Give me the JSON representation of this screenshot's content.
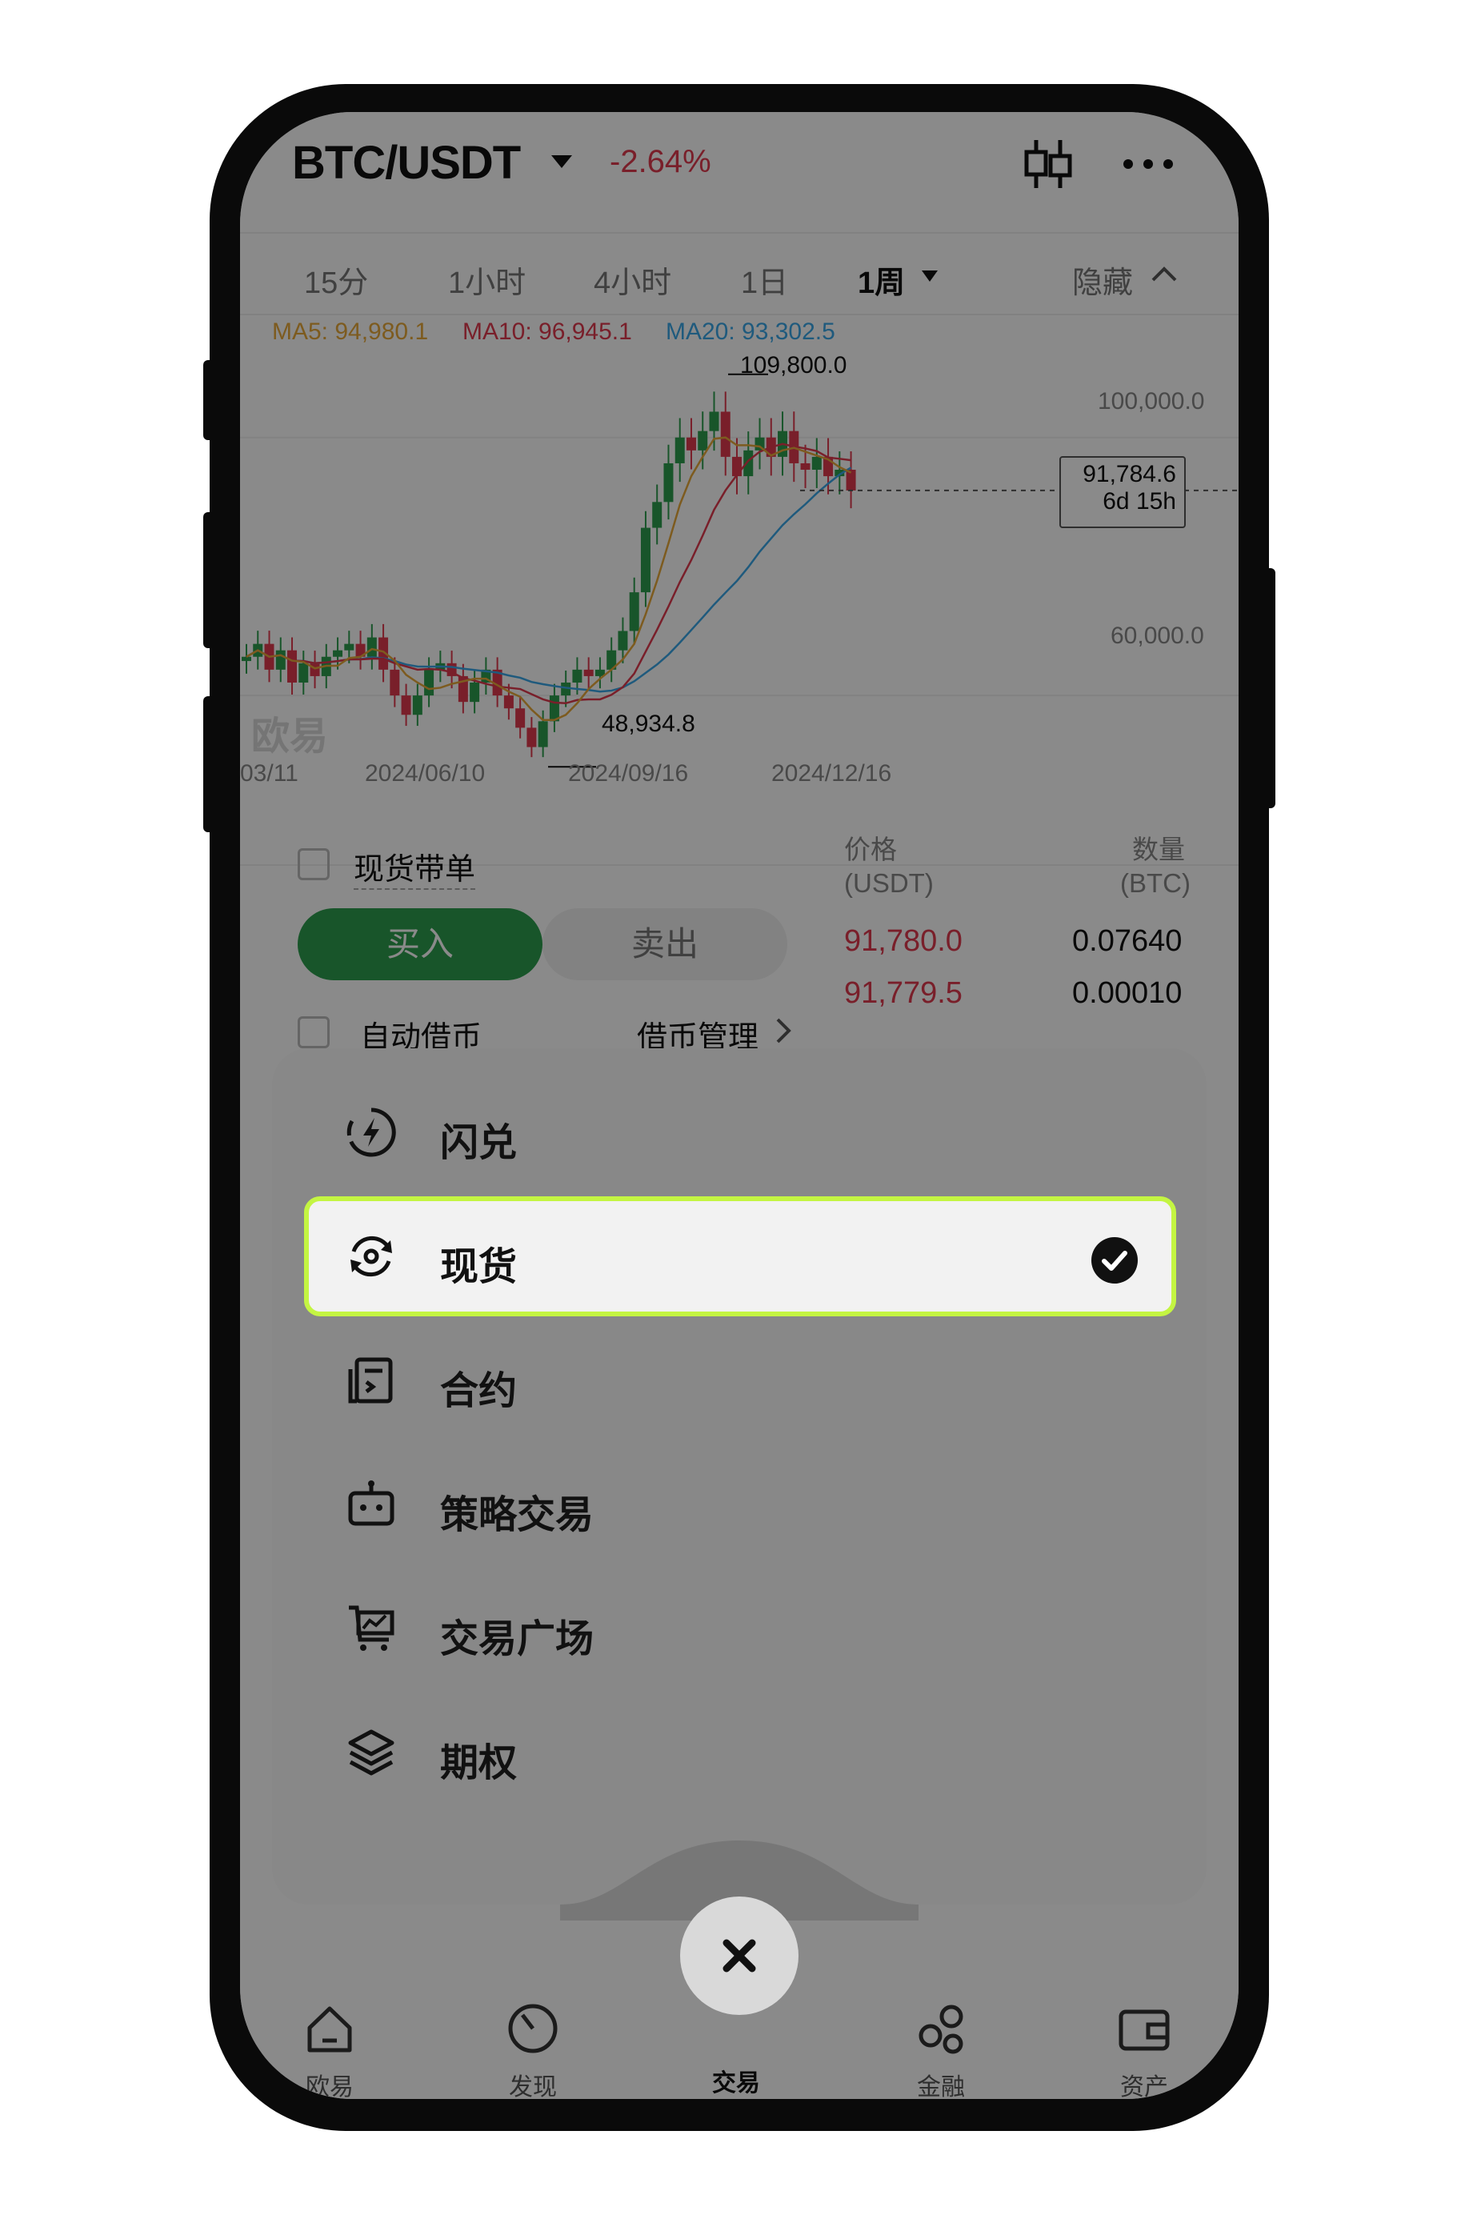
{
  "header": {
    "pair": "BTC/USDT",
    "change": "-2.64%"
  },
  "timeframes": [
    {
      "label": "15分"
    },
    {
      "label": "1小时"
    },
    {
      "label": "4小时"
    },
    {
      "label": "1日"
    },
    {
      "label": "1周"
    }
  ],
  "hide_label": "隐藏",
  "ma": {
    "ma5": "MA5: 94,980.1",
    "ma10": "MA10: 96,945.1",
    "ma20": "MA20: 93,302.5"
  },
  "chart": {
    "high_label": "109,800.0",
    "low_label": "48,934.8",
    "y_ticks": [
      "100,000.0",
      "60,000.0"
    ],
    "x_ticks": [
      "03/11",
      "2024/06/10",
      "2024/09/16",
      "2024/12/16"
    ],
    "current_price": "91,784.6",
    "countdown": "6d 15h",
    "watermark": "欧易",
    "colors": {
      "up": "#2e9e4e",
      "down": "#e03a4e",
      "ma5": "#e7a93a",
      "ma10": "#e03a4e",
      "ma20": "#3aa7e7"
    }
  },
  "chart_data": {
    "type": "candlestick",
    "title": "",
    "ylim": [
      45000,
      112000
    ],
    "y_ticks": [
      60000,
      100000
    ],
    "x_ticks": [
      "03/11",
      "2024/06/10",
      "2024/09/16",
      "2024/12/16"
    ],
    "high": 109800.0,
    "low": 48934.8,
    "last": 91784.6,
    "closes": [
      66000,
      68000,
      64000,
      67000,
      62000,
      65000,
      63000,
      66000,
      67000,
      68000,
      66000,
      69000,
      64000,
      60000,
      57000,
      60000,
      64000,
      65000,
      63000,
      59000,
      62000,
      64000,
      60000,
      58000,
      55000,
      52000,
      56000,
      60000,
      62000,
      64000,
      63000,
      64000,
      67000,
      70000,
      76000,
      86000,
      90000,
      96000,
      100000,
      98000,
      101000,
      104000,
      97000,
      94000,
      98000,
      100000,
      97000,
      101000,
      96000,
      95000,
      97000,
      94000,
      95000,
      91784.6
    ]
  },
  "trade_panel": {
    "spot_margin": "现货带单",
    "buy": "买入",
    "sell": "卖出",
    "auto_borrow": "自动借币",
    "borrow_manage": "借币管理",
    "price_header": "价格",
    "price_unit": "(USDT)",
    "qty_header": "数量",
    "qty_unit": "(BTC)",
    "asks": [
      {
        "price": "91,780.0",
        "qty": "0.07640"
      },
      {
        "price": "91,779.5",
        "qty": "0.00010"
      }
    ]
  },
  "menu": {
    "items": [
      {
        "label": "闪兑",
        "icon": "flash-swap-icon"
      },
      {
        "label": "现货",
        "icon": "spot-icon",
        "selected": true
      },
      {
        "label": "合约",
        "icon": "contract-icon"
      },
      {
        "label": "策略交易",
        "icon": "robot-icon"
      },
      {
        "label": "交易广场",
        "icon": "cart-icon"
      },
      {
        "label": "期权",
        "icon": "layers-icon"
      }
    ]
  },
  "bottom_nav": [
    {
      "label": "欧易",
      "icon": "home-icon"
    },
    {
      "label": "发现",
      "icon": "discover-icon"
    },
    {
      "label": "交易",
      "icon": "close-icon"
    },
    {
      "label": "金融",
      "icon": "finance-icon"
    },
    {
      "label": "资产",
      "icon": "wallet-icon"
    }
  ]
}
